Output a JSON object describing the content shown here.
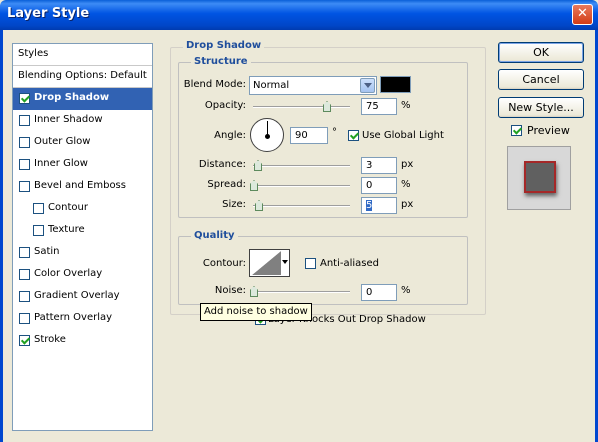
{
  "window": {
    "title": "Layer Style",
    "close_glyph": "✕"
  },
  "styles_panel": {
    "header": "Styles",
    "items": [
      {
        "label": "Blending Options: Default"
      },
      {
        "label": "Drop Shadow",
        "checked": true,
        "selected": true
      },
      {
        "label": "Inner Shadow",
        "checked": false
      },
      {
        "label": "Outer Glow",
        "checked": false
      },
      {
        "label": "Inner Glow",
        "checked": false
      },
      {
        "label": "Bevel and Emboss",
        "checked": false
      },
      {
        "label": "Contour",
        "checked": false
      },
      {
        "label": "Texture",
        "checked": false
      },
      {
        "label": "Satin",
        "checked": false
      },
      {
        "label": "Color Overlay",
        "checked": false
      },
      {
        "label": "Gradient Overlay",
        "checked": false
      },
      {
        "label": "Pattern Overlay",
        "checked": false
      },
      {
        "label": "Stroke",
        "checked": true
      }
    ]
  },
  "drop_shadow": {
    "title": "Drop Shadow",
    "structure": {
      "title": "Structure",
      "blend_mode_label": "Blend Mode:",
      "blend_mode_value": "Normal",
      "shadow_color": "#000000",
      "opacity_label": "Opacity:",
      "opacity_value": "75",
      "opacity_unit": "%",
      "opacity_level": 0.75,
      "angle_label": "Angle:",
      "angle_value": "90",
      "angle_unit": "°",
      "use_global_light_label": "Use Global Light",
      "use_global_light": true,
      "distance_label": "Distance:",
      "distance_value": "3",
      "distance_unit": "px",
      "spread_label": "Spread:",
      "spread_value": "0",
      "spread_unit": "%",
      "size_label": "Size:",
      "size_value": "5",
      "size_unit": "px"
    },
    "quality": {
      "title": "Quality",
      "contour_label": "Contour:",
      "anti_aliased_label": "Anti-aliased",
      "anti_aliased": false,
      "noise_label": "Noise:",
      "noise_value": "0",
      "noise_unit": "%",
      "knocks_out_label": "Layer Knocks Out Drop Shadow",
      "knocks_out": true
    },
    "tooltip": "Add noise to shadow"
  },
  "buttons": {
    "ok": "OK",
    "cancel": "Cancel",
    "new_style": "New Style..."
  },
  "preview": {
    "label": "Preview",
    "checked": true
  }
}
